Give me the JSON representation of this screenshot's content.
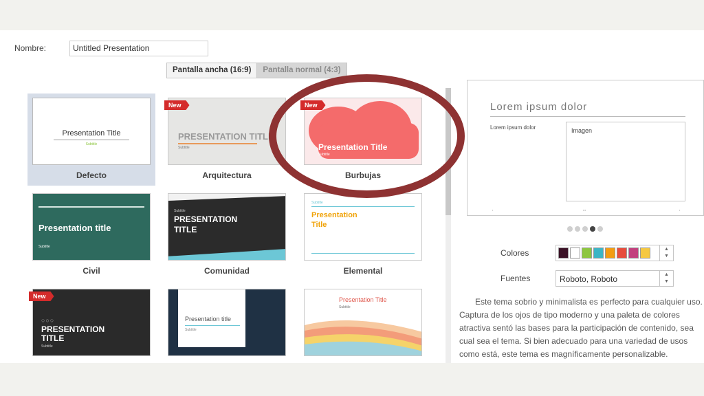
{
  "form": {
    "name_label": "Nombre:",
    "name_value": "Untitled Presentation"
  },
  "aspect_tabs": {
    "wide": "Pantalla ancha (16:9)",
    "normal": "Pantalla normal (4:3)",
    "selected": "wide"
  },
  "themes": [
    {
      "id": "defecto",
      "label": "Defecto",
      "selected": true,
      "is_new": false,
      "thumb_title": "Presentation Title",
      "thumb_subtitle": "Subtitle"
    },
    {
      "id": "arquitectura",
      "label": "Arquitectura",
      "selected": false,
      "is_new": true,
      "thumb_title": "PRESENTATION TITLE",
      "thumb_subtitle": "Subtitle"
    },
    {
      "id": "burbujas",
      "label": "Burbujas",
      "selected": false,
      "is_new": true,
      "thumb_title": "Presentation Title",
      "thumb_subtitle": "Subtitle"
    },
    {
      "id": "civil",
      "label": "Civil",
      "selected": false,
      "is_new": false,
      "thumb_title": "Presentation title",
      "thumb_subtitle": "Subtitle"
    },
    {
      "id": "comunidad",
      "label": "Comunidad",
      "selected": false,
      "is_new": false,
      "thumb_title": "PRESENTATION TITLE",
      "thumb_subtitle": "Subtitle"
    },
    {
      "id": "elemental",
      "label": "Elemental",
      "selected": false,
      "is_new": false,
      "thumb_title": "Presentation Title",
      "thumb_subtitle": "Subtitle"
    },
    {
      "id": "row3-1",
      "label": "",
      "selected": false,
      "is_new": true,
      "thumb_title": "PRESENTATION TITLE",
      "thumb_subtitle": "Subtitle"
    },
    {
      "id": "row3-2",
      "label": "",
      "selected": false,
      "is_new": false,
      "thumb_title": "Presentation title",
      "thumb_subtitle": "Subtitle"
    },
    {
      "id": "row3-3",
      "label": "",
      "selected": false,
      "is_new": false,
      "thumb_title": "Presentation Title",
      "thumb_subtitle": "Subtitle"
    }
  ],
  "new_badge": "New",
  "preview": {
    "title": "Lorem ipsum dolor",
    "body_text": "Lorem ipsum dolor",
    "image_label": "Imagen",
    "dots_count": 5,
    "active_dot": 4
  },
  "colors": {
    "label": "Colores",
    "swatches": [
      "#3b1226",
      "#ffffff",
      "#8dc63f",
      "#3cb5c5",
      "#f39c12",
      "#e74c3c",
      "#c2407d",
      "#f5c842"
    ]
  },
  "fonts": {
    "label": "Fuentes",
    "value": "Roboto, Roboto"
  },
  "description": "Este tema sobrio y minimalista es perfecto para cualquier uso. Captura de los ojos de tipo moderno y una paleta de colores atractiva sentó las bases para la participación de contenido, sea cual sea el tema. Si bien adecuado para una variedad de usos como está, este tema es magníficamente personalizable.",
  "accent_colors": {
    "highlight_ring": "#8e3232",
    "burbujas": "#f46b6b",
    "civil": "#2e6a5e",
    "comunidad": "#333333",
    "elemental_title": "#f0a30a"
  }
}
